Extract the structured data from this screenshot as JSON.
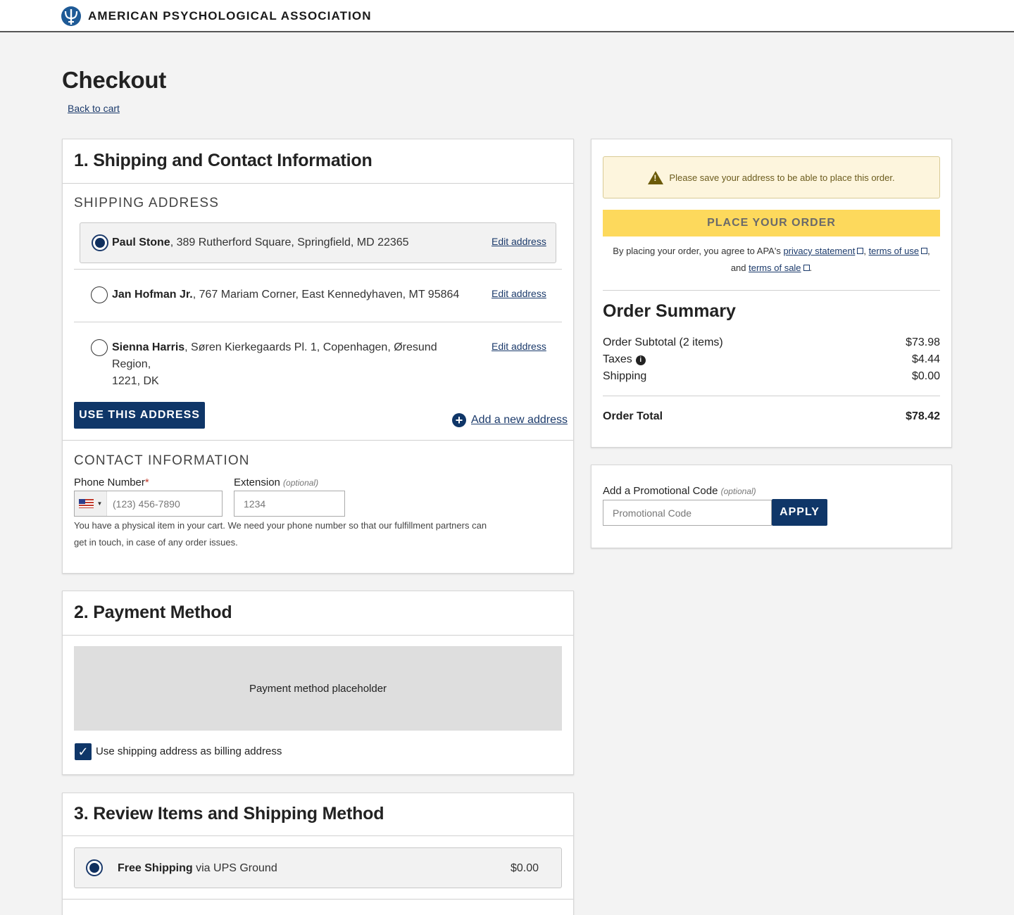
{
  "header": {
    "org_name": "AMERICAN PSYCHOLOGICAL ASSOCIATION"
  },
  "page": {
    "title": "Checkout",
    "back_link": "Back to cart"
  },
  "shipping": {
    "title": "1. Shipping and Contact Information",
    "address_label": "SHIPPING ADDRESS",
    "addresses": [
      {
        "name": "Paul Stone",
        "address": ", 389 Rutherford Square, Springfield, MD 22365",
        "edit": "Edit address",
        "selected": true
      },
      {
        "name": "Jan Hofman Jr.",
        "address": ", 767 Mariam Corner, East Kennedyhaven, MT 95864",
        "edit": "Edit address",
        "selected": false
      },
      {
        "name": "Sienna Harris",
        "address": ", Søren Kierkegaards Pl. 1, Copenhagen, Øresund Region,",
        "address_line2": "1221, DK",
        "edit": "Edit address",
        "selected": false
      }
    ],
    "use_address_button": "USE THIS ADDRESS",
    "add_new_address": "Add a new address",
    "contact_label": "CONTACT INFORMATION",
    "phone_label": "Phone Number",
    "phone_required": "*",
    "phone_placeholder": "(123) 456-7890",
    "extension_label": "Extension",
    "extension_optional": "(optional)",
    "extension_placeholder": "1234",
    "help_text_line1": "You have a physical item in your cart. We need your phone number so that our fulfillment partners can",
    "help_text_line2": "get in touch, in case of any order issues."
  },
  "payment": {
    "title": "2. Payment Method",
    "placeholder": "Payment method placeholder",
    "billing_checkbox_label": "Use shipping address as billing address",
    "billing_checked": true
  },
  "review": {
    "title": "3. Review Items and Shipping Method",
    "shipping_option_name": "Free Shipping",
    "shipping_option_via": " via UPS Ground",
    "shipping_option_price": "$0.00"
  },
  "order": {
    "warning": "Please save your address to be able to place this order.",
    "place_button": "PLACE YOUR ORDER",
    "agree_prefix": "By placing your order, you agree to APA's ",
    "privacy_link": "privacy statement",
    "terms_use_link": "terms of use",
    "agree_and": "and ",
    "terms_sale_link": "terms of sale",
    "summary_title": "Order Summary",
    "subtotal_label": "Order Subtotal (2 items)",
    "subtotal_value": "$73.98",
    "taxes_label": "Taxes",
    "taxes_value": "$4.44",
    "shipping_label": "Shipping",
    "shipping_value": "$0.00",
    "total_label": "Order Total",
    "total_value": "$78.42"
  },
  "promo": {
    "label": "Add a Promotional Code",
    "optional": "(optional)",
    "placeholder": "Promotional Code",
    "apply_button": "APPLY"
  }
}
